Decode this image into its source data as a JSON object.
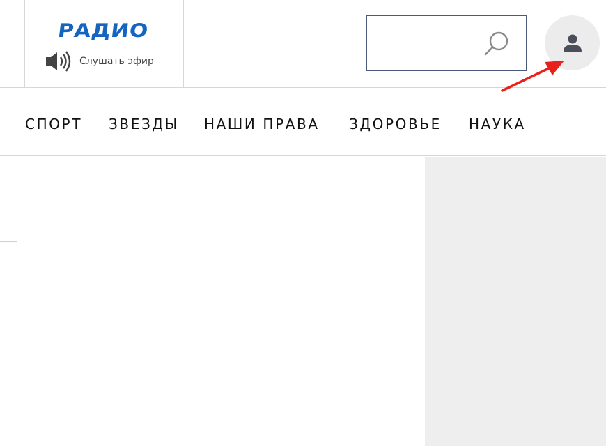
{
  "header": {
    "radio": {
      "logo_text": "РАДИО",
      "listen_label": "Слушать эфир",
      "speaker_icon": "speaker-icon"
    },
    "search": {
      "value": "",
      "placeholder": "",
      "icon": "search-icon"
    },
    "user": {
      "icon": "user-icon"
    },
    "annotation": {
      "icon": "red-arrow",
      "color": "#e8211a"
    }
  },
  "nav": {
    "items": [
      {
        "label": "СПОРТ"
      },
      {
        "label": "ЗВЕЗДЫ"
      },
      {
        "label": "НАШИ ПРАВА"
      },
      {
        "label": "ЗДОРОВЬЕ"
      },
      {
        "label": "НАУКА"
      }
    ]
  },
  "colors": {
    "brand": "#1565c0",
    "search_border": "#4a5a78",
    "user_button_bg": "#ececec",
    "side_panel_bg": "#eeeeee",
    "divider": "#d6d6d6"
  }
}
